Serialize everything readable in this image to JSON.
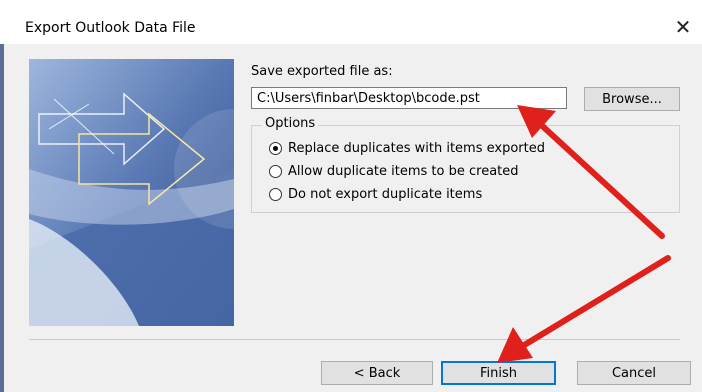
{
  "window": {
    "title": "Export Outlook Data File",
    "close_glyph": "✕"
  },
  "save_section": {
    "label": "Save exported file as:",
    "path_value": "C:\\Users\\finbar\\Desktop\\bcode.pst",
    "browse_label": "Browse..."
  },
  "options": {
    "legend": "Options",
    "items": [
      {
        "label": "Replace duplicates with items exported",
        "checked": true
      },
      {
        "label": "Allow duplicate items to be created",
        "checked": false
      },
      {
        "label": "Do not export duplicate items",
        "checked": false
      }
    ]
  },
  "footer": {
    "back_label": "< Back",
    "finish_label": "Finish",
    "cancel_label": "Cancel"
  },
  "colors": {
    "arrow": "#e0201b",
    "focus": "#0078d7",
    "banner": "#3b5a96"
  },
  "icons": {
    "close": "close-icon",
    "banner": "export-wizard-graphic"
  }
}
